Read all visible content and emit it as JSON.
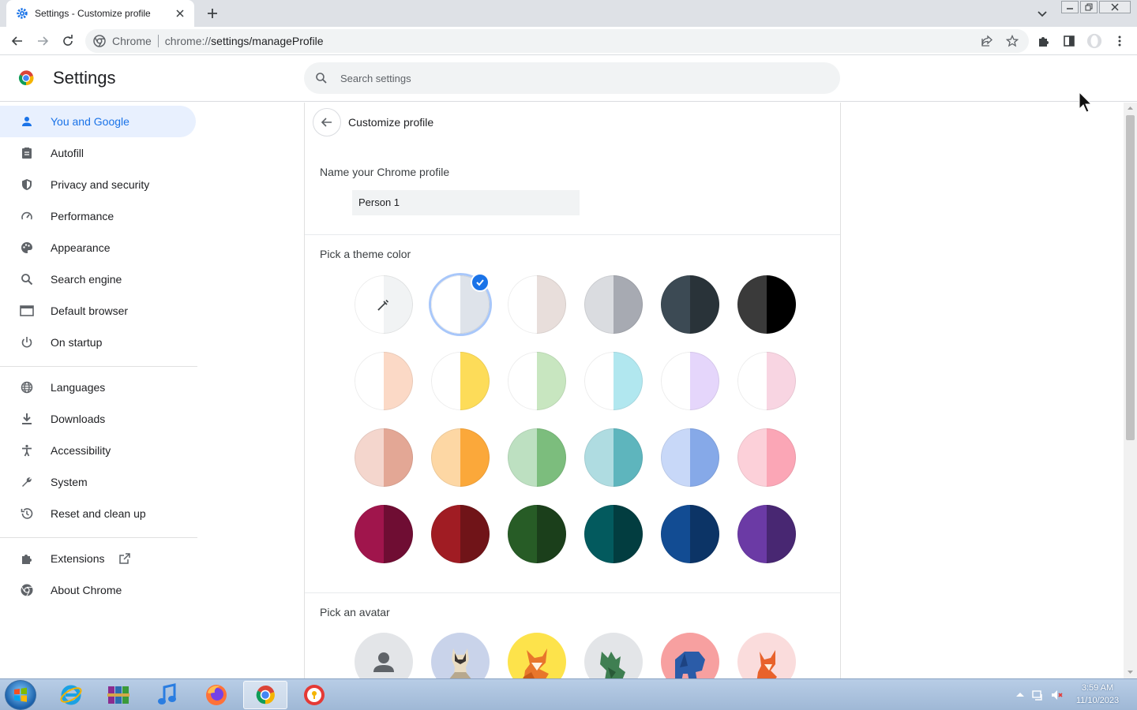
{
  "browser": {
    "tab_title": "Settings - Customize profile",
    "omnibox_site": "Chrome",
    "url_scheme": "chrome://",
    "url_path": "settings/manageProfile"
  },
  "settings": {
    "title": "Settings",
    "search_placeholder": "Search settings"
  },
  "sidebar": {
    "items": [
      {
        "label": "You and Google",
        "icon": "person-icon",
        "active": true
      },
      {
        "label": "Autofill",
        "icon": "clipboard-icon"
      },
      {
        "label": "Privacy and security",
        "icon": "shield-icon"
      },
      {
        "label": "Performance",
        "icon": "speedometer-icon"
      },
      {
        "label": "Appearance",
        "icon": "palette-icon"
      },
      {
        "label": "Search engine",
        "icon": "search-icon"
      },
      {
        "label": "Default browser",
        "icon": "browser-window-icon"
      },
      {
        "label": "On startup",
        "icon": "power-icon"
      },
      {
        "label": "Languages",
        "icon": "globe-icon"
      },
      {
        "label": "Downloads",
        "icon": "download-icon"
      },
      {
        "label": "Accessibility",
        "icon": "accessibility-icon"
      },
      {
        "label": "System",
        "icon": "wrench-icon"
      },
      {
        "label": "Reset and clean up",
        "icon": "history-icon"
      },
      {
        "label": "Extensions",
        "icon": "puzzle-icon"
      },
      {
        "label": "About Chrome",
        "icon": "chrome-icon"
      }
    ]
  },
  "main": {
    "page_title": "Customize profile",
    "name_label": "Name your Chrome profile",
    "name_value": "Person 1",
    "theme_label": "Pick a theme color",
    "avatar_label": "Pick an avatar",
    "theme_colors": [
      {
        "left": "#ffffff",
        "right": "#f1f3f4",
        "picker": true
      },
      {
        "left": "#ffffff",
        "right": "#dee3ea",
        "selected": true
      },
      {
        "left": "#ffffff",
        "right": "#e8dedb"
      },
      {
        "left": "#dadce0",
        "right": "#a7aab2"
      },
      {
        "left": "#3c4a54",
        "right": "#293339"
      },
      {
        "left": "#3a3a3a",
        "right": "#000000"
      },
      {
        "left": "#ffffff",
        "right": "#fbd9c6"
      },
      {
        "left": "#ffffff",
        "right": "#fddc59"
      },
      {
        "left": "#ffffff",
        "right": "#c8e6c0"
      },
      {
        "left": "#ffffff",
        "right": "#b1e7ef"
      },
      {
        "left": "#ffffff",
        "right": "#e5d6fb"
      },
      {
        "left": "#ffffff",
        "right": "#f8d5e2"
      },
      {
        "left": "#f4d6cd",
        "right": "#e3a795"
      },
      {
        "left": "#fdd7a4",
        "right": "#fba83a"
      },
      {
        "left": "#bde0c1",
        "right": "#7cbd7d"
      },
      {
        "left": "#afdce1",
        "right": "#5eb5bd"
      },
      {
        "left": "#c8d8f8",
        "right": "#86a9e8"
      },
      {
        "left": "#fcd0d9",
        "right": "#fba6b6"
      },
      {
        "left": "#a0154c",
        "right": "#6f0d33"
      },
      {
        "left": "#a01c23",
        "right": "#701418"
      },
      {
        "left": "#275c26",
        "right": "#1b3f1b"
      },
      {
        "left": "#035a5e",
        "right": "#023d40"
      },
      {
        "left": "#124c93",
        "right": "#0c3466"
      },
      {
        "left": "#6b3aa5",
        "right": "#482772"
      }
    ],
    "avatars": [
      {
        "name": "default-avatar",
        "bg": "#e3e5e8"
      },
      {
        "name": "cat-avatar",
        "bg": "#c9d3ea"
      },
      {
        "name": "fox-avatar",
        "bg": "#fde34b"
      },
      {
        "name": "dragon-avatar",
        "bg": "#e3e5e8"
      },
      {
        "name": "elephant-avatar",
        "bg": "#f7a0a0"
      },
      {
        "name": "fox-pink-avatar",
        "bg": "#fadcdc"
      }
    ]
  },
  "taskbar": {
    "time": "3:59 AM",
    "date": "11/10/2023"
  },
  "colors": {
    "accent": "#1a73e8",
    "active_nav_bg": "#e8f0fe"
  }
}
